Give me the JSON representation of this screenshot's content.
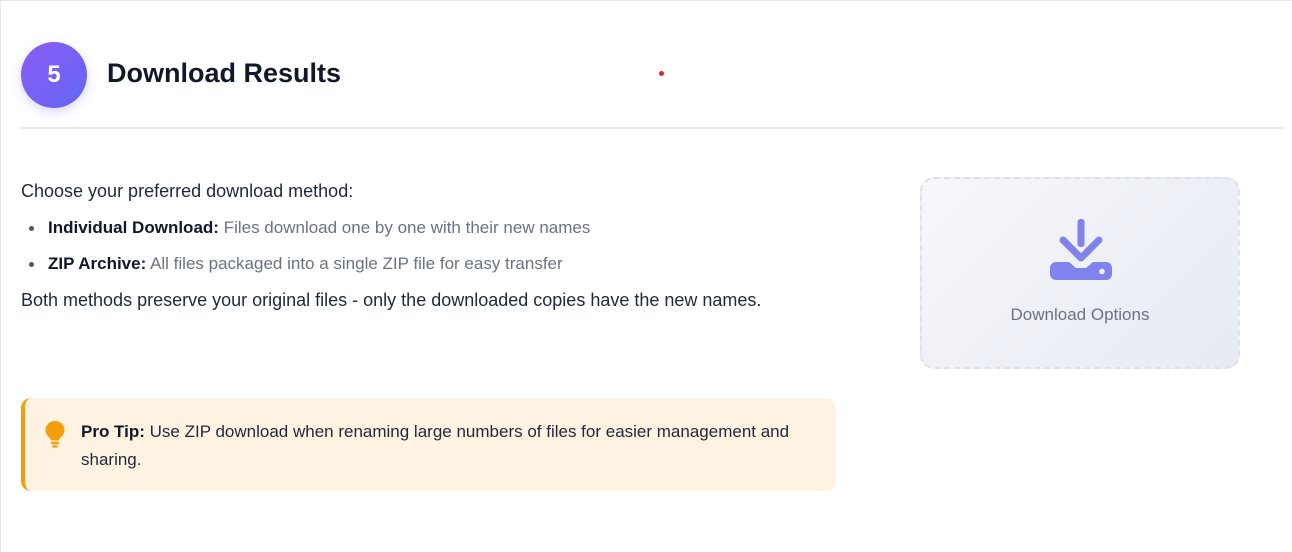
{
  "step": {
    "number": "5",
    "title": "Download Results"
  },
  "content": {
    "intro": "Choose your preferred download method:",
    "methods": [
      {
        "label": "Individual Download:",
        "description": "Files download one by one with their new names"
      },
      {
        "label": "ZIP Archive:",
        "description": "All files packaged into a single ZIP file for easy transfer"
      }
    ],
    "note": "Both methods preserve your original files - only the downloaded copies have the new names."
  },
  "tip": {
    "icon": "lightbulb-icon",
    "label": "Pro Tip:",
    "text": "Use ZIP download when renaming large numbers of files for easier management and sharing."
  },
  "download_card": {
    "icon": "download-icon",
    "label": "Download Options"
  },
  "colors": {
    "badge_gradient_start": "#8b5cf6",
    "badge_gradient_end": "#6366f1",
    "tip_background": "#fef3e2",
    "tip_accent": "#f59e0b",
    "download_icon": "#8083ee"
  }
}
